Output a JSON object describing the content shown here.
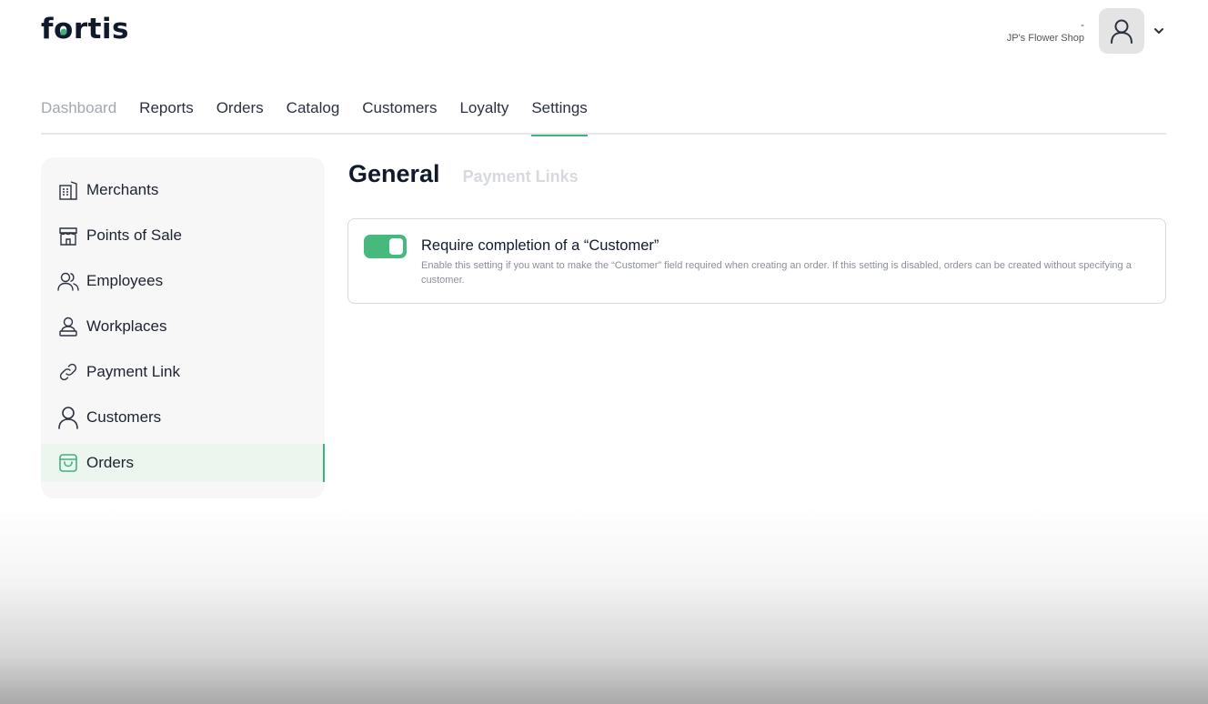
{
  "brand": {
    "logo_text_pre": "f",
    "logo_text_o": "o",
    "logo_text_post": "rtis",
    "accent": "#3fb27f"
  },
  "account": {
    "dash": "-",
    "shop_name": "JP's Flower Shop",
    "avatar_icon": "user-icon",
    "menu_icon": "chevron-down-icon"
  },
  "topnav": {
    "items": [
      {
        "label": "Dashboard",
        "state": "muted"
      },
      {
        "label": "Reports"
      },
      {
        "label": "Orders"
      },
      {
        "label": "Catalog"
      },
      {
        "label": "Customers"
      },
      {
        "label": "Loyalty"
      },
      {
        "label": "Settings",
        "state": "active"
      }
    ]
  },
  "sidebar": {
    "items": [
      {
        "label": "Merchants",
        "icon": "building-icon"
      },
      {
        "label": "Points of Sale",
        "icon": "storefront-icon"
      },
      {
        "label": "Employees",
        "icon": "users-icon"
      },
      {
        "label": "Workplaces",
        "icon": "workplace-stamp-icon"
      },
      {
        "label": "Payment Link",
        "icon": "link-icon"
      },
      {
        "label": "Customers",
        "icon": "user-icon"
      },
      {
        "label": "Orders",
        "icon": "shopping-bag-icon",
        "active": true
      }
    ]
  },
  "content": {
    "tabs": {
      "general": "General",
      "payment_links": "Payment Links"
    },
    "setting": {
      "enabled": true,
      "title": "Require completion of a “Customer”",
      "description": "Enable this setting if you want to make the “Customer” field required when creating an order. If this setting is disabled, orders can be created without specifying a customer."
    }
  }
}
